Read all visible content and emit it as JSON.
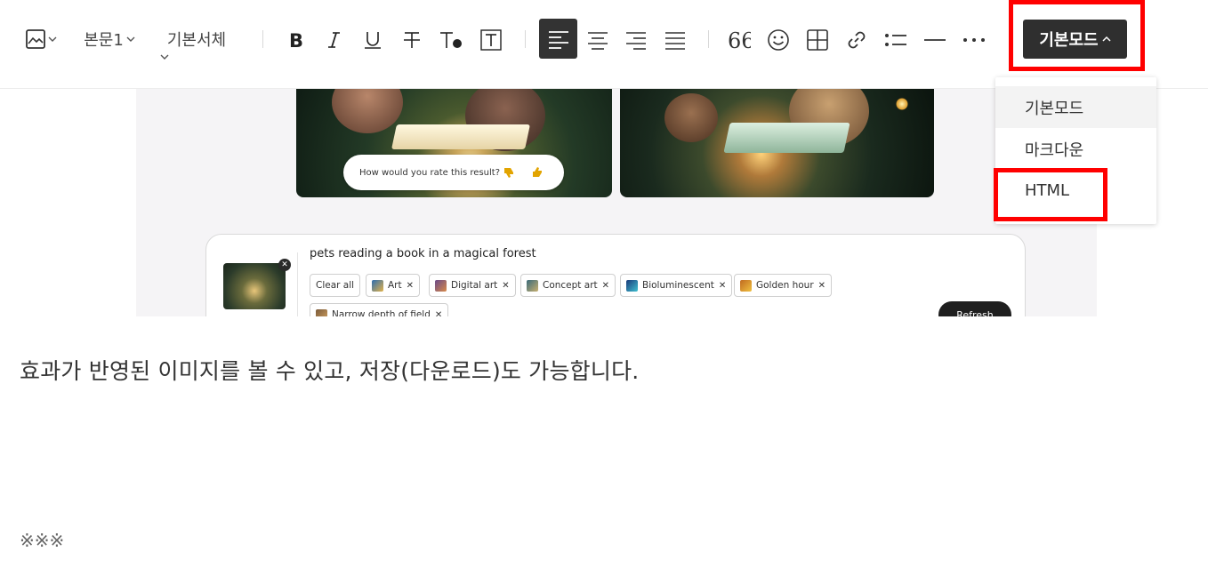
{
  "toolbar": {
    "paragraph_style": "본문1",
    "font": "기본서체",
    "mode_label": "기본모드",
    "colors": {
      "active_bg": "#333333",
      "highlight": "#ff0000"
    }
  },
  "dropdown": {
    "items": [
      {
        "label": "기본모드",
        "selected": true
      },
      {
        "label": "마크다운",
        "selected": false
      },
      {
        "label": "HTML",
        "selected": false
      }
    ]
  },
  "embed": {
    "rating_prompt": "How would you rate this result?",
    "prompt_text": "pets reading a book in a magical forest",
    "clear_all": "Clear all",
    "chips": [
      "Art",
      "Digital art",
      "Concept art",
      "Bioluminescent",
      "Golden hour",
      "Narrow depth of field"
    ],
    "refresh_label": "Refresh"
  },
  "body": {
    "line1": "효과가 반영된 이미지를 볼 수 있고, 저장(다운로드)도 가능합니다.",
    "line2": "※※※"
  }
}
